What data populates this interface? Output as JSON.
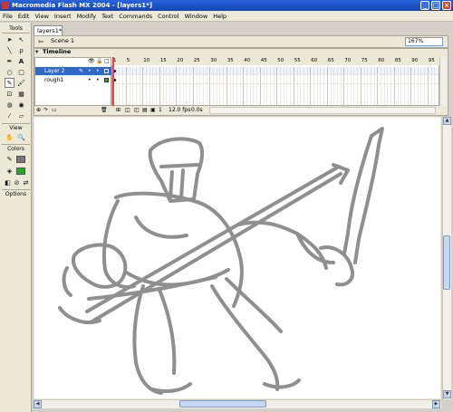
{
  "window": {
    "title": "Macromedia Flash MX 2004 - [layers1*]"
  },
  "menu": [
    "File",
    "Edit",
    "View",
    "Insert",
    "Modify",
    "Text",
    "Commands",
    "Control",
    "Window",
    "Help"
  ],
  "tools": {
    "header": "Tools",
    "view_label": "View",
    "colors_label": "Colors",
    "options_label": "Options",
    "stroke_color": "#777777",
    "fill_color": "#22aa22"
  },
  "document": {
    "tab": "layers1*",
    "scene": "Scene 1",
    "zoom": "167%"
  },
  "timeline": {
    "title": "Timeline",
    "layers": [
      {
        "name": "Layer 2",
        "selected": true,
        "color": "#3366ff"
      },
      {
        "name": "rough1",
        "selected": false,
        "color": "#22aa22"
      }
    ],
    "frame_numbers": [
      "1",
      "5",
      "10",
      "15",
      "20",
      "25",
      "30",
      "35",
      "40",
      "45",
      "50",
      "55",
      "60",
      "65",
      "70",
      "75",
      "80",
      "85",
      "90",
      "95"
    ],
    "current_frame": "1",
    "fps": "12.0 fps",
    "elapsed": "0.0s"
  }
}
